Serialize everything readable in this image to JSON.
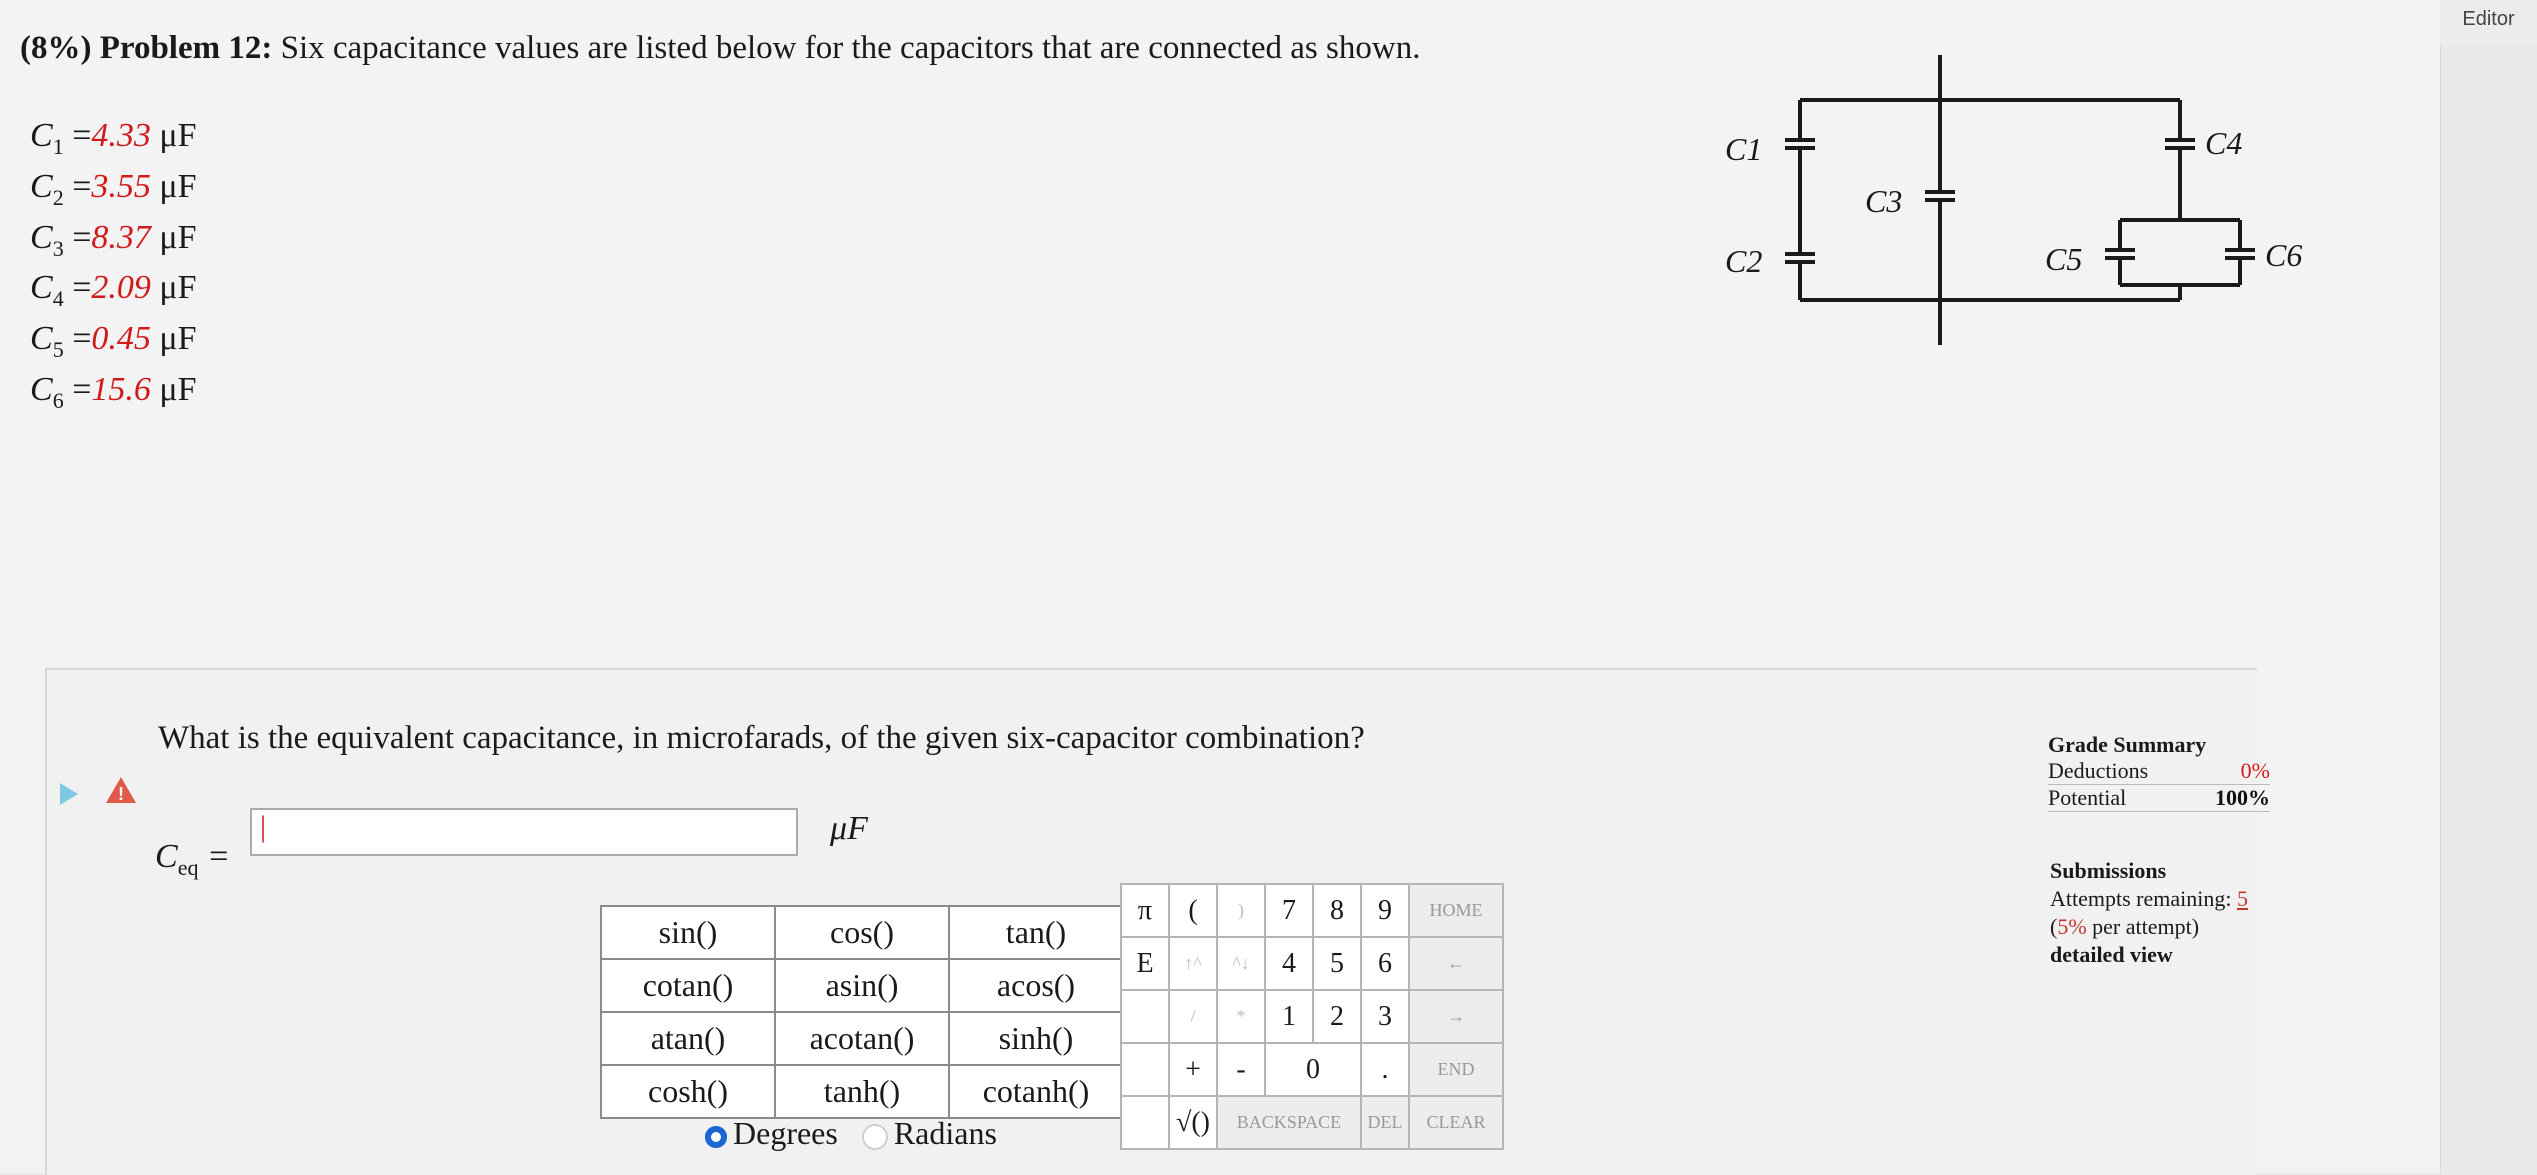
{
  "window": {
    "editor_label": "Editor"
  },
  "problem": {
    "weight": "(8%)",
    "number": "Problem 12:",
    "statement": "Six capacitance values are listed below for the capacitors that are connected as shown."
  },
  "capacitors": [
    {
      "name": "C",
      "sub": "1",
      "eq": " =",
      "value": "4.33",
      "unit": " μF"
    },
    {
      "name": "C",
      "sub": "2",
      "eq": " =",
      "value": "3.55",
      "unit": " μF"
    },
    {
      "name": "C",
      "sub": "3",
      "eq": " =",
      "value": "8.37",
      "unit": " μF"
    },
    {
      "name": "C",
      "sub": "4",
      "eq": " =",
      "value": "2.09",
      "unit": " μF"
    },
    {
      "name": "C",
      "sub": "5",
      "eq": " =",
      "value": "0.45",
      "unit": " μF"
    },
    {
      "name": "C",
      "sub": "6",
      "eq": " =",
      "value": "15.6",
      "unit": " μF"
    }
  ],
  "circuit_labels": {
    "c1": "C1",
    "c2": "C2",
    "c3": "C3",
    "c4": "C4",
    "c5": "C5",
    "c6": "C6"
  },
  "question": {
    "text": "What is the equivalent capacitance, in microfarads, of the given six-capacitor combination?",
    "answer_label_main": "C",
    "answer_label_sub": "eq",
    "answer_label_eq": " =",
    "answer_value": "|",
    "unit": "μF"
  },
  "functions": [
    [
      "sin()",
      "cos()",
      "tan()"
    ],
    [
      "cotan()",
      "asin()",
      "acos()"
    ],
    [
      "atan()",
      "acotan()",
      "sinh()"
    ],
    [
      "cosh()",
      "tanh()",
      "cotanh()"
    ]
  ],
  "angle_mode": {
    "degrees": "Degrees",
    "radians": "Radians",
    "selected": "Degrees"
  },
  "keypad": {
    "pi": "π",
    "e": "E",
    "open_paren": "(",
    "close_paren": ")",
    "up": "↑^",
    "down": "^↓",
    "slash": "/",
    "star": "*",
    "plus": "+",
    "minus": "-",
    "sqrt": "√()",
    "digits": [
      "7",
      "8",
      "9",
      "4",
      "5",
      "6",
      "1",
      "2",
      "3",
      "0",
      "."
    ],
    "home": "HOME",
    "back_arrow": "←",
    "fwd_arrow": "→",
    "end": "END",
    "backspace": "BACKSPACE",
    "del": "DEL",
    "clear": "CLEAR"
  },
  "grade_summary": {
    "title": "Grade Summary",
    "deductions_label": "Deductions",
    "deductions_value": "0%",
    "potential_label": "Potential",
    "potential_value": "100%"
  },
  "submissions": {
    "title": "Submissions",
    "attempts_label": "Attempts remaining:",
    "attempts_value": "5",
    "per_attempt_open": "(",
    "per_attempt_pct": "5%",
    "per_attempt_text": " per attempt)",
    "detailed_link": "detailed view"
  }
}
